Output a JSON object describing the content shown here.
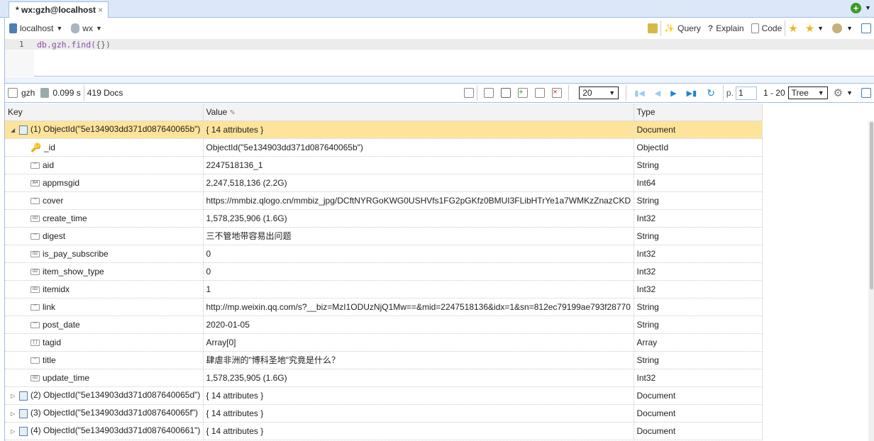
{
  "tab": {
    "title": "* wx:gzh@localhost",
    "close": "×"
  },
  "toolbar": {
    "host": "localhost",
    "db": "wx",
    "query": "Query",
    "explain": "Explain",
    "code": "Code"
  },
  "editor": {
    "line": "1",
    "code_obj": "db.gzh.find(",
    "code_brace": "{}",
    "code_end": ")"
  },
  "results": {
    "collection": "gzh",
    "time": "0.099 s",
    "docs": "419 Docs",
    "page_size": "20",
    "page_label": "p.",
    "page": "1",
    "range": "1 - 20",
    "view": "Tree"
  },
  "columns": [
    "Key",
    "Value",
    "Type"
  ],
  "rows": [
    {
      "key": "(1) ObjectId(\"5e134903dd371d087640065b\")",
      "value": "{ 14 attributes }",
      "type": "Document",
      "kind": "doc",
      "expanded": true
    },
    {
      "key": "_id",
      "value": "ObjectId(\"5e134903dd371d087640065b\")",
      "type": "ObjectId",
      "kind": "key"
    },
    {
      "key": "aid",
      "value": "2247518136_1",
      "type": "String",
      "kind": "str",
      "icon": "\"\""
    },
    {
      "key": "appmsgid",
      "value": "2,247,518,136 (2.2G)",
      "type": "Int64",
      "kind": "int",
      "icon": "i64"
    },
    {
      "key": "cover",
      "value": "https://mmbiz.qlogo.cn/mmbiz_jpg/DCftNYRGoKWG0USHVfs1FG2pGKfz0BMUI3FLibHTrYe1a7WMKzZnazCKD",
      "type": "String",
      "kind": "str",
      "icon": "\"\""
    },
    {
      "key": "create_time",
      "value": "1,578,235,906 (1.6G)",
      "type": "Int32",
      "kind": "int",
      "icon": "i32"
    },
    {
      "key": "digest",
      "value": "三不管地带容易出问题",
      "type": "String",
      "kind": "str",
      "icon": "\"\""
    },
    {
      "key": "is_pay_subscribe",
      "value": "0",
      "type": "Int32",
      "kind": "int",
      "icon": "i32"
    },
    {
      "key": "item_show_type",
      "value": "0",
      "type": "Int32",
      "kind": "int",
      "icon": "i32"
    },
    {
      "key": "itemidx",
      "value": "1",
      "type": "Int32",
      "kind": "int",
      "icon": "i32"
    },
    {
      "key": "link",
      "value": "http://mp.weixin.qq.com/s?__biz=MzI1ODUzNjQ1Mw==&mid=2247518136&idx=1&sn=812ec79199ae793f28770",
      "type": "String",
      "kind": "str",
      "icon": "\"\""
    },
    {
      "key": "post_date",
      "value": "2020-01-05",
      "type": "String",
      "kind": "str",
      "icon": "\"\""
    },
    {
      "key": "tagid",
      "value": "Array[0]",
      "type": "Array",
      "kind": "arr",
      "icon": "[ ]"
    },
    {
      "key": "title",
      "value": "肆虐非洲的\"博科圣地\"究竟是什么？",
      "type": "String",
      "kind": "str",
      "icon": "\"\""
    },
    {
      "key": "update_time",
      "value": "1,578,235,905 (1.6G)",
      "type": "Int32",
      "kind": "int",
      "icon": "i32"
    },
    {
      "key": "(2) ObjectId(\"5e134903dd371d087640065d\")",
      "value": "{ 14 attributes }",
      "type": "Document",
      "kind": "doc"
    },
    {
      "key": "(3) ObjectId(\"5e134903dd371d087640065f\")",
      "value": "{ 14 attributes }",
      "type": "Document",
      "kind": "doc"
    },
    {
      "key": "(4) ObjectId(\"5e134903dd371d0876400661\")",
      "value": "{ 14 attributes }",
      "type": "Document",
      "kind": "doc"
    }
  ],
  "colors": {
    "highlight": "#fde49a",
    "border": "#9fbfe6",
    "code": "#8a4fa8"
  }
}
